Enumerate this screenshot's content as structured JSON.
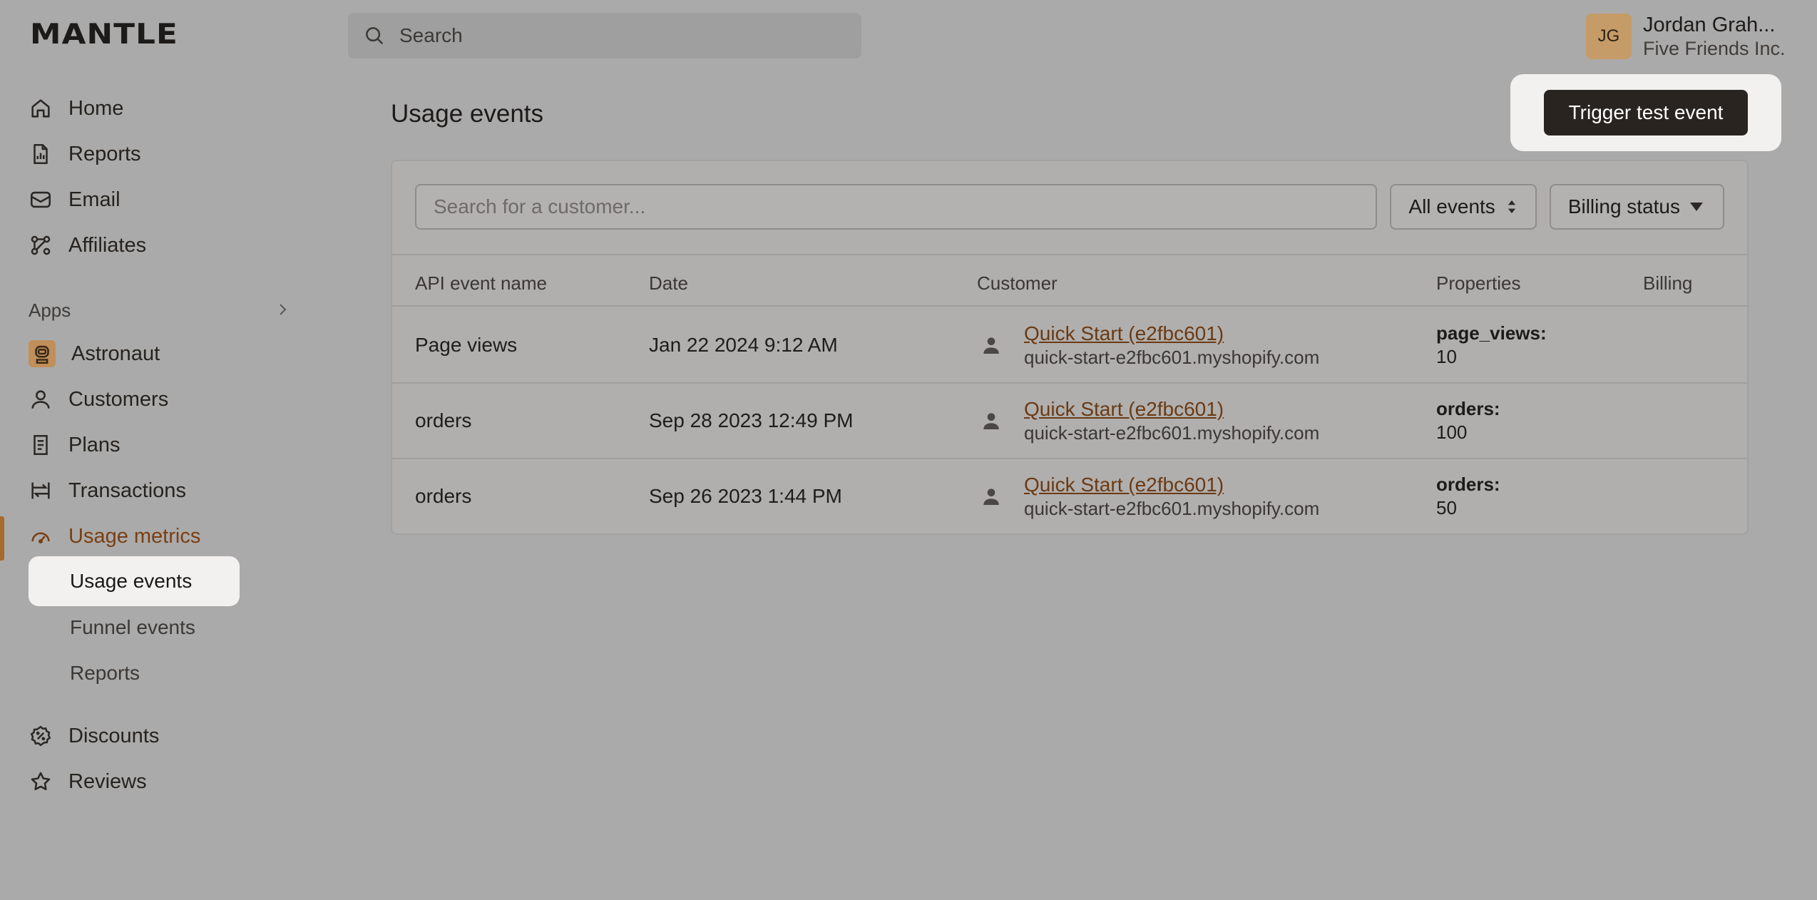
{
  "app": {
    "logo": "MANTLE"
  },
  "search": {
    "placeholder": "Search"
  },
  "user": {
    "initials": "JG",
    "name": "Jordan Grah...",
    "org": "Five Friends Inc."
  },
  "sidebar": {
    "items": [
      {
        "label": "Home",
        "icon": "home-icon"
      },
      {
        "label": "Reports",
        "icon": "report-icon"
      },
      {
        "label": "Email",
        "icon": "mail-icon"
      },
      {
        "label": "Affiliates",
        "icon": "affiliates-icon"
      }
    ],
    "apps_label": "Apps",
    "app_name": "Astronaut",
    "app_items": [
      {
        "label": "Customers",
        "icon": "person-icon"
      },
      {
        "label": "Plans",
        "icon": "receipt-icon"
      },
      {
        "label": "Transactions",
        "icon": "transactions-icon"
      },
      {
        "label": "Usage metrics",
        "icon": "gauge-icon"
      }
    ],
    "sub_items": [
      {
        "label": "Usage events"
      },
      {
        "label": "Funnel events"
      },
      {
        "label": "Reports"
      }
    ],
    "bottom_items": [
      {
        "label": "Discounts",
        "icon": "discount-icon"
      },
      {
        "label": "Reviews",
        "icon": "star-icon"
      }
    ]
  },
  "main": {
    "title": "Usage events",
    "trigger_label": "Trigger test event",
    "customer_search_placeholder": "Search for a customer...",
    "events_filter": "All events",
    "billing_filter": "Billing status",
    "columns": [
      "API event name",
      "Date",
      "Customer",
      "Properties",
      "Billing"
    ],
    "rows": [
      {
        "event": "Page views",
        "date": "Jan 22 2024 9:12 AM",
        "customer": "Quick Start (e2fbc601)",
        "domain": "quick-start-e2fbc601.myshopify.com",
        "prop_key": "page_views:",
        "prop_val": "10"
      },
      {
        "event": "orders",
        "date": "Sep 28 2023 12:49 PM",
        "customer": "Quick Start (e2fbc601)",
        "domain": "quick-start-e2fbc601.myshopify.com",
        "prop_key": "orders:",
        "prop_val": "100"
      },
      {
        "event": "orders",
        "date": "Sep 26 2023 1:44 PM",
        "customer": "Quick Start (e2fbc601)",
        "domain": "quick-start-e2fbc601.myshopify.com",
        "prop_key": "orders:",
        "prop_val": "50"
      }
    ]
  },
  "colors": {
    "accent": "#7a3f12",
    "active_bar": "#a86a2d",
    "button_dark": "#2a2420",
    "avatar": "#c59b67"
  }
}
